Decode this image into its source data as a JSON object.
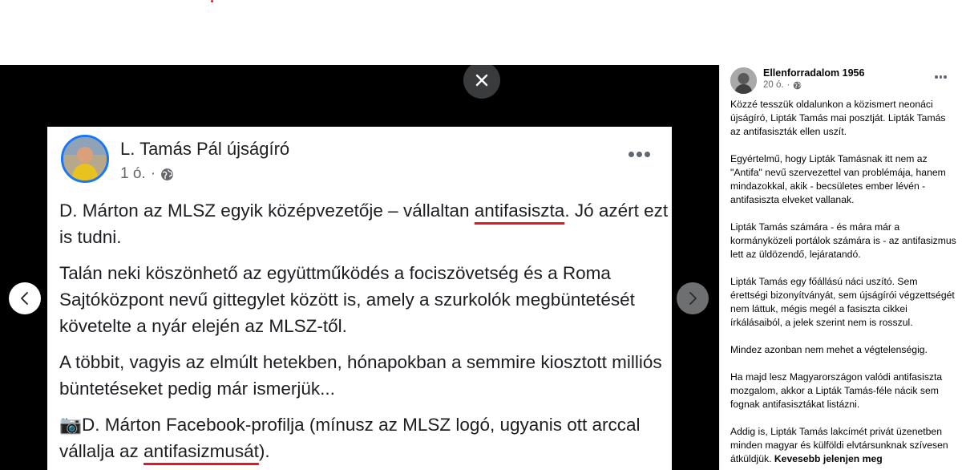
{
  "viewer": {
    "close_icon": "close-icon",
    "prev_icon": "chevron-left-icon",
    "next_icon": "chevron-right-icon"
  },
  "shared_post": {
    "author": "L. Tamás Pál újságíró",
    "time": "1 ó.",
    "separator": "·",
    "privacy_icon": "globe-icon",
    "paragraphs": [
      {
        "before": "D. Márton az MLSZ egyik középvezetője – vállaltan ",
        "highlight": "antifasiszta",
        "after": ". Jó azért ezt is tudni."
      },
      {
        "text": "Talán neki köszönhető az együttműködés a fociszövetség és a Roma Sajtóközpont nevű gittegylet között is, amely a szurkolók megbüntetését követelte a nyár elején az MLSZ-től."
      },
      {
        "text": "A többit, vagyis az elmúlt hetekben, hónapokban a semmire kiosztott milliós büntetéseket pedig már ismerjük..."
      },
      {
        "before": "📷D. Márton Facebook-profilja (mínusz az MLSZ logó, ugyanis ott arccal vállalja az ",
        "highlight": "antifasizmusát",
        "after": ")."
      }
    ]
  },
  "sidebar": {
    "page_name": "Ellenforradalom 1956",
    "time": "20 ó.",
    "separator": "·",
    "privacy_icon": "globe-icon",
    "paragraphs": [
      "Közzé tesszük oldalunkon a közismert neonáci újságíró, Lipták Tamás mai posztját. Lipták Tamás az antifasiszták ellen uszít.",
      "Egyértelmű, hogy Lipták Tamásnak itt nem az \"Antifa\" nevű szervezettel van problémája, hanem mindazokkal, akik - becsületes ember lévén - antifasiszta elveket vallanak.",
      "Lipták Tamás számára - és mára már a kormányközeli portálok számára is - az antifasizmus lett az üldözendő, lejáratandó.",
      "Lipták Tamás egy főállású náci uszító. Sem érettségi bizonyítványát, sem újságírói végzettségét nem láttuk, mégis megél a fasiszta cikkei írkálásaiból, a jelek szerint nem is rosszul.",
      "Mindez azonban nem mehet a végtelenségig.",
      "Ha majd lesz Magyarországon valódi antifasiszta mozgalom, akkor a Lipták Tamás-féle nácik sem fognak antifasisztákat listázni."
    ],
    "last_paragraph": "Addig is, Lipták Tamás lakcímét privát üzenetben minden magyar és külföldi elvtársunknak szívesen átküldjük. ",
    "see_more": "Kevesebb jelenjen meg"
  },
  "colors": {
    "underline": "#e0182d",
    "avatar_ring": "#1877f2"
  }
}
